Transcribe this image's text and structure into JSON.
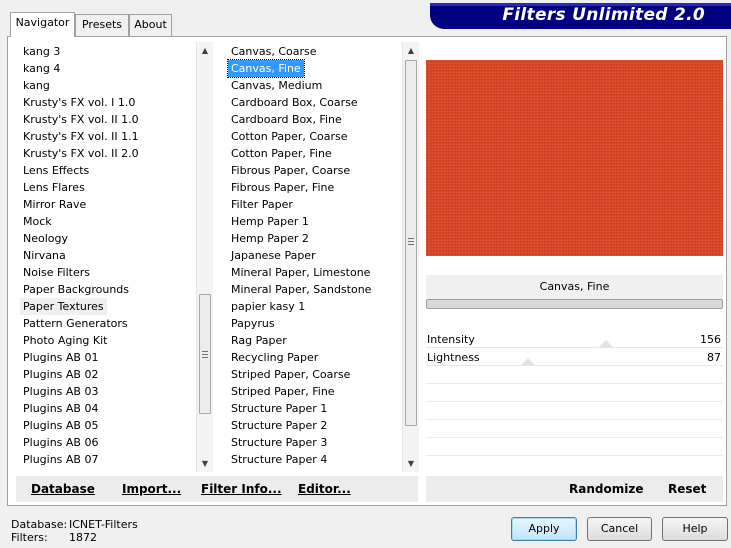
{
  "banner": {
    "title": "Filters Unlimited 2.0"
  },
  "tabs": [
    {
      "label": "Navigator",
      "active": true
    },
    {
      "label": "Presets",
      "active": false
    },
    {
      "label": "About",
      "active": false
    }
  ],
  "categories": {
    "items": [
      "kang 3",
      "kang 4",
      "kang",
      "Krusty's FX vol. I 1.0",
      "Krusty's FX vol. II 1.0",
      "Krusty's FX vol. II 1.1",
      "Krusty's FX vol. II 2.0",
      "Lens Effects",
      "Lens Flares",
      "Mirror Rave",
      "Mock",
      "Neology",
      "Nirvana",
      "Noise Filters",
      "Paper Backgrounds",
      "Paper Textures",
      "Pattern Generators",
      "Photo Aging Kit",
      "Plugins AB 01",
      "Plugins AB 02",
      "Plugins AB 03",
      "Plugins AB 04",
      "Plugins AB 05",
      "Plugins AB 06",
      "Plugins AB 07"
    ],
    "highlighted": "Paper Textures"
  },
  "filters": {
    "items": [
      "Canvas, Coarse",
      "Canvas, Fine",
      "Canvas, Medium",
      "Cardboard Box, Coarse",
      "Cardboard Box, Fine",
      "Cotton Paper, Coarse",
      "Cotton Paper, Fine",
      "Fibrous Paper, Coarse",
      "Fibrous Paper, Fine",
      "Filter Paper",
      "Hemp Paper 1",
      "Hemp Paper 2",
      "Japanese Paper",
      "Mineral Paper, Limestone",
      "Mineral Paper, Sandstone",
      "papier kasy 1",
      "Papyrus",
      "Rag Paper",
      "Recycling Paper",
      "Striped Paper, Coarse",
      "Striped Paper, Fine",
      "Structure Paper 1",
      "Structure Paper 2",
      "Structure Paper 3",
      "Structure Paper 4"
    ],
    "selected": "Canvas, Fine"
  },
  "preview": {
    "filter_name": "Canvas, Fine",
    "texture_color": "#e0441f"
  },
  "params": [
    {
      "label": "Intensity",
      "value": "156"
    },
    {
      "label": "Lightness",
      "value": "87"
    }
  ],
  "commands": {
    "database": "Database",
    "import": "Import...",
    "filter_info": "Filter Info...",
    "editor": "Editor...",
    "randomize": "Randomize",
    "reset": "Reset"
  },
  "status": {
    "database_label": "Database:",
    "database_value": "ICNET-Filters",
    "filters_label": "Filters:",
    "filters_value": "1872"
  },
  "buttons": {
    "apply": "Apply",
    "cancel": "Cancel",
    "help": "Help"
  },
  "icons": {
    "scroll_up": "scroll-up-arrow-icon",
    "scroll_down": "scroll-down-arrow-icon",
    "scroll_grip": "scroll-grip-icon"
  }
}
